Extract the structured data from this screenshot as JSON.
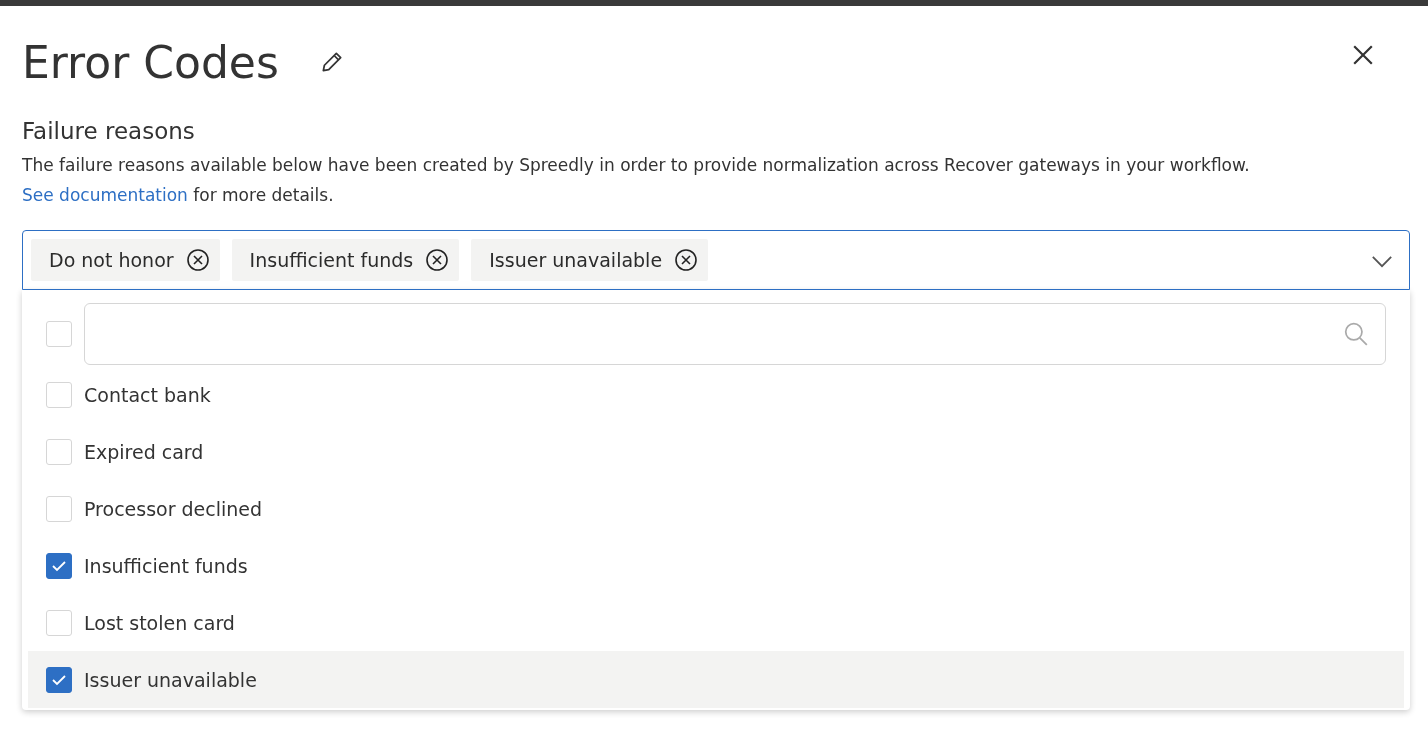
{
  "title": "Error Codes",
  "section": {
    "heading": "Failure reasons",
    "description": "The failure reasons available below have been created by Spreedly in order to provide normalization across Recover gateways in your workflow.",
    "link": "See documentation",
    "suffix": "for more details."
  },
  "selected_tags": [
    {
      "label": "Do not honor"
    },
    {
      "label": "Insufficient funds"
    },
    {
      "label": "Issuer unavailable"
    }
  ],
  "dropdown": {
    "expanded": true,
    "select_all_checked": false,
    "options": [
      {
        "label": "Contact bank",
        "checked": false,
        "highlighted": false
      },
      {
        "label": "Expired card",
        "checked": false,
        "highlighted": false
      },
      {
        "label": "Processor declined",
        "checked": false,
        "highlighted": false
      },
      {
        "label": "Insufficient funds",
        "checked": true,
        "highlighted": false
      },
      {
        "label": "Lost stolen card",
        "checked": false,
        "highlighted": false
      },
      {
        "label": "Issuer unavailable",
        "checked": true,
        "highlighted": true
      }
    ]
  }
}
